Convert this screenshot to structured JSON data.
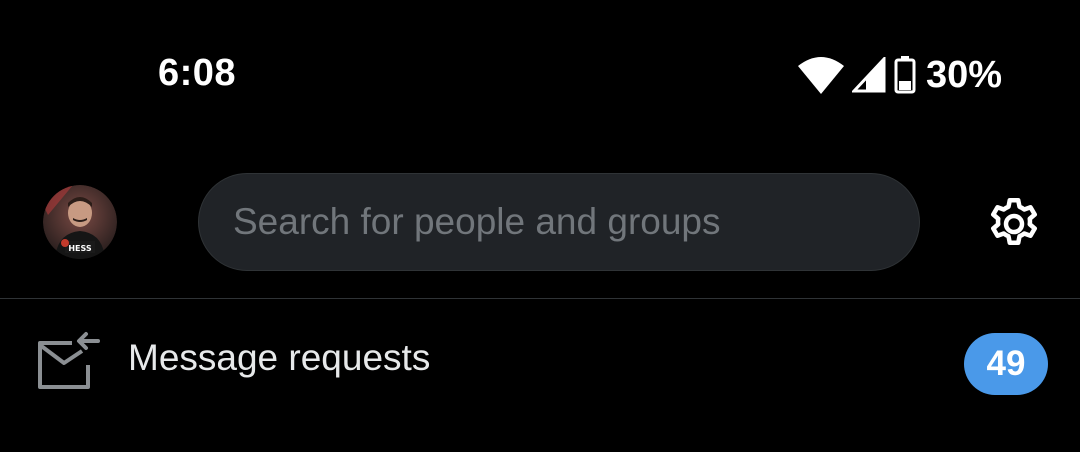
{
  "status_bar": {
    "time": "6:08",
    "battery_percent": "30%",
    "icons": [
      "wifi-icon",
      "cell-signal-icon",
      "battery-icon"
    ]
  },
  "header": {
    "avatar_icon": "user-avatar",
    "search": {
      "placeholder": "Search for people and groups",
      "value": ""
    },
    "settings_icon": "gear-icon"
  },
  "message_requests": {
    "icon": "mail-incoming-icon",
    "label": "Message requests",
    "count": "49"
  },
  "colors": {
    "background": "#000000",
    "search_background": "#202327",
    "placeholder": "#71767b",
    "divider": "#2f3336",
    "badge": "#4a99e9",
    "text": "#e7e9ea"
  }
}
